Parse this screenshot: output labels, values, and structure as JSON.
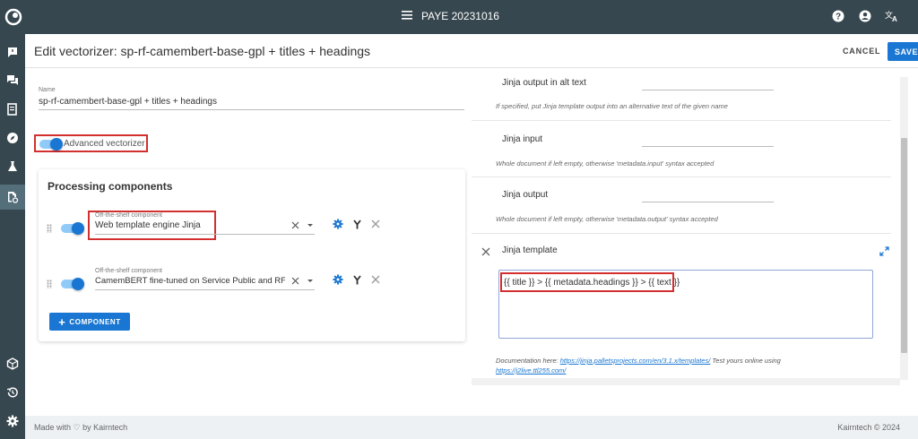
{
  "topbar": {
    "title": "PAYE 20231016"
  },
  "header": {
    "title": "Edit vectorizer: sp-rf-camembert-base-gpl + titles + headings",
    "cancel_label": "CANCEL",
    "save_label": "SAVE"
  },
  "form": {
    "name_label": "Name",
    "name_value": "sp-rf-camembert-base-gpl + titles + headings",
    "advanced_label": "Advanced vectorizer"
  },
  "processing": {
    "title": "Processing components",
    "components": [
      {
        "label": "Off-the-shelf component",
        "value": "Web template engine Jinja"
      },
      {
        "label": "Off-the-shelf component",
        "value": "CamemBERT fine-tuned on Service Public and RF cc"
      }
    ],
    "add_label": "COMPONENT"
  },
  "jinja": {
    "alt_label": "Jinja output in alt text",
    "alt_hint": "If specified, put Jinja template output into an alternative text of the given name",
    "input_label": "Jinja input",
    "input_hint": "Whole document if left empty, otherwise 'metadata.input' syntax accepted",
    "output_label": "Jinja output",
    "output_hint": "Whole document if left empty, otherwise 'metadata.output' syntax accepted",
    "template_label": "Jinja template",
    "template_value": "{{ title }} > {{ metadata.headings }} > {{ text }}",
    "doc_prefix": "Documentation here: ",
    "doc_link": "https://jinja.palletsprojects.com/en/3.1.x/templates/",
    "doc_middle": " Test yours online using ",
    "doc_link2": "https://j2live.ttl255.com/"
  },
  "footer": {
    "left": "Made with ♡ by Kairntech",
    "right": "Kairntech © 2024"
  },
  "colors": {
    "primary": "#1976d2",
    "topbar": "#37474f",
    "highlight": "#d32f2f"
  }
}
